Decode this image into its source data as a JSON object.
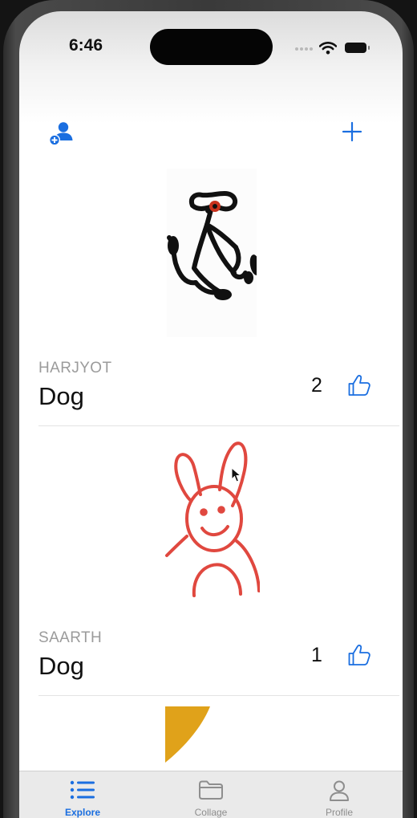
{
  "status_bar": {
    "time": "6:46"
  },
  "header": {
    "add_friend_icon": "person-add-icon",
    "add_post_icon": "plus-icon"
  },
  "posts": [
    {
      "author": "HARJYOT",
      "title": "Dog",
      "likes": "2",
      "like_icon": "thumbs-up-icon",
      "drawing_color": "#111111"
    },
    {
      "author": "SAARTH",
      "title": "Dog",
      "likes": "1",
      "like_icon": "thumbs-up-icon",
      "drawing_color": "#e0483f"
    },
    {
      "drawing_color": "#e0a21a"
    }
  ],
  "tabs": [
    {
      "label": "Explore",
      "icon": "list-icon",
      "active": true
    },
    {
      "label": "Collage",
      "icon": "folder-icon",
      "active": false
    },
    {
      "label": "Profile",
      "icon": "person-icon",
      "active": false
    }
  ],
  "colors": {
    "accent": "#1a6ee0",
    "muted": "#9b9b9b"
  }
}
